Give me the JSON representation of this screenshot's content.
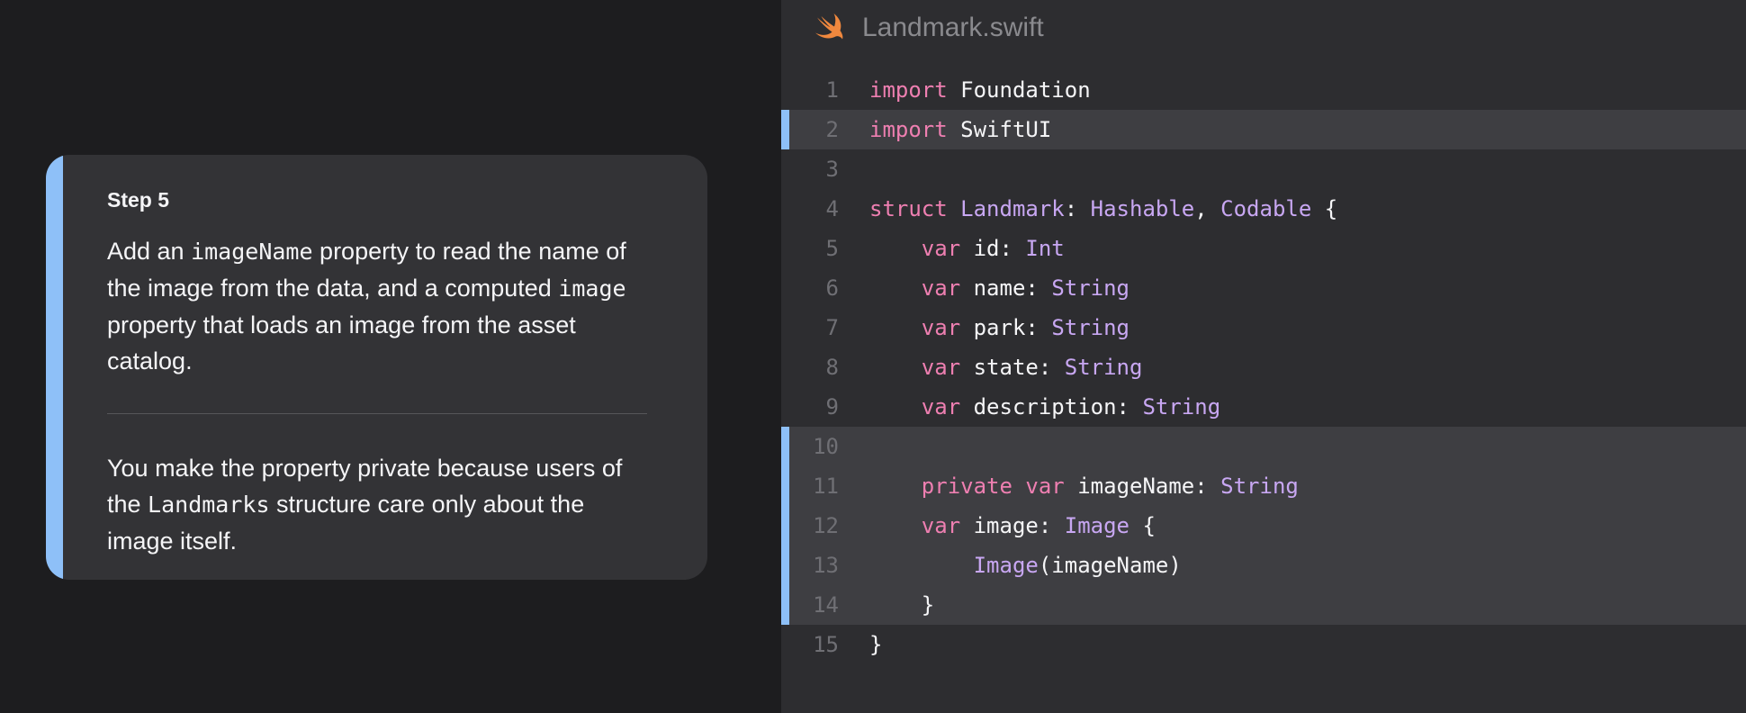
{
  "step": {
    "label": "Step 5",
    "paragraph1": [
      {
        "text": "Add an ",
        "code": false
      },
      {
        "text": "imageName",
        "code": true
      },
      {
        "text": " property to read the name of the image from the data, and a computed ",
        "code": false
      },
      {
        "text": "image",
        "code": true
      },
      {
        "text": " property that loads an image from the asset catalog.",
        "code": false
      }
    ],
    "paragraph2": [
      {
        "text": "You make the property private because users of the ",
        "code": false
      },
      {
        "text": "Landmarks",
        "code": true
      },
      {
        "text": " structure care only about the image itself.",
        "code": false
      }
    ]
  },
  "editor": {
    "file_name": "Landmark.swift",
    "file_icon": "swift-icon",
    "colors": {
      "accent": "#8ec0f8",
      "keyword": "#ee7fb1",
      "type": "#c8a7f2",
      "plain": "#f5f5f7"
    },
    "lines": [
      {
        "number": "1",
        "highlight": false,
        "tokens": [
          [
            "kw",
            "import"
          ],
          [
            "plain",
            " Foundation"
          ]
        ]
      },
      {
        "number": "2",
        "highlight": true,
        "tokens": [
          [
            "kw",
            "import"
          ],
          [
            "plain",
            " SwiftUI"
          ]
        ]
      },
      {
        "number": "3",
        "highlight": false,
        "tokens": []
      },
      {
        "number": "4",
        "highlight": false,
        "tokens": [
          [
            "kw",
            "struct"
          ],
          [
            "plain",
            " "
          ],
          [
            "type",
            "Landmark"
          ],
          [
            "plain",
            ": "
          ],
          [
            "type",
            "Hashable"
          ],
          [
            "plain",
            ", "
          ],
          [
            "type",
            "Codable"
          ],
          [
            "plain",
            " {"
          ]
        ]
      },
      {
        "number": "5",
        "highlight": false,
        "tokens": [
          [
            "plain",
            "    "
          ],
          [
            "kw",
            "var"
          ],
          [
            "plain",
            " id: "
          ],
          [
            "type",
            "Int"
          ]
        ]
      },
      {
        "number": "6",
        "highlight": false,
        "tokens": [
          [
            "plain",
            "    "
          ],
          [
            "kw",
            "var"
          ],
          [
            "plain",
            " name: "
          ],
          [
            "type",
            "String"
          ]
        ]
      },
      {
        "number": "7",
        "highlight": false,
        "tokens": [
          [
            "plain",
            "    "
          ],
          [
            "kw",
            "var"
          ],
          [
            "plain",
            " park: "
          ],
          [
            "type",
            "String"
          ]
        ]
      },
      {
        "number": "8",
        "highlight": false,
        "tokens": [
          [
            "plain",
            "    "
          ],
          [
            "kw",
            "var"
          ],
          [
            "plain",
            " state: "
          ],
          [
            "type",
            "String"
          ]
        ]
      },
      {
        "number": "9",
        "highlight": false,
        "tokens": [
          [
            "plain",
            "    "
          ],
          [
            "kw",
            "var"
          ],
          [
            "plain",
            " description: "
          ],
          [
            "type",
            "String"
          ]
        ]
      },
      {
        "number": "10",
        "highlight": true,
        "tokens": []
      },
      {
        "number": "11",
        "highlight": true,
        "tokens": [
          [
            "plain",
            "    "
          ],
          [
            "kw",
            "private"
          ],
          [
            "plain",
            " "
          ],
          [
            "kw",
            "var"
          ],
          [
            "plain",
            " imageName: "
          ],
          [
            "type",
            "String"
          ]
        ]
      },
      {
        "number": "12",
        "highlight": true,
        "tokens": [
          [
            "plain",
            "    "
          ],
          [
            "kw",
            "var"
          ],
          [
            "plain",
            " image: "
          ],
          [
            "type",
            "Image"
          ],
          [
            "plain",
            " {"
          ]
        ]
      },
      {
        "number": "13",
        "highlight": true,
        "tokens": [
          [
            "plain",
            "        "
          ],
          [
            "type",
            "Image"
          ],
          [
            "plain",
            "(imageName)"
          ]
        ]
      },
      {
        "number": "14",
        "highlight": true,
        "tokens": [
          [
            "plain",
            "    }"
          ]
        ]
      },
      {
        "number": "15",
        "highlight": false,
        "tokens": [
          [
            "plain",
            "}"
          ]
        ]
      }
    ]
  }
}
